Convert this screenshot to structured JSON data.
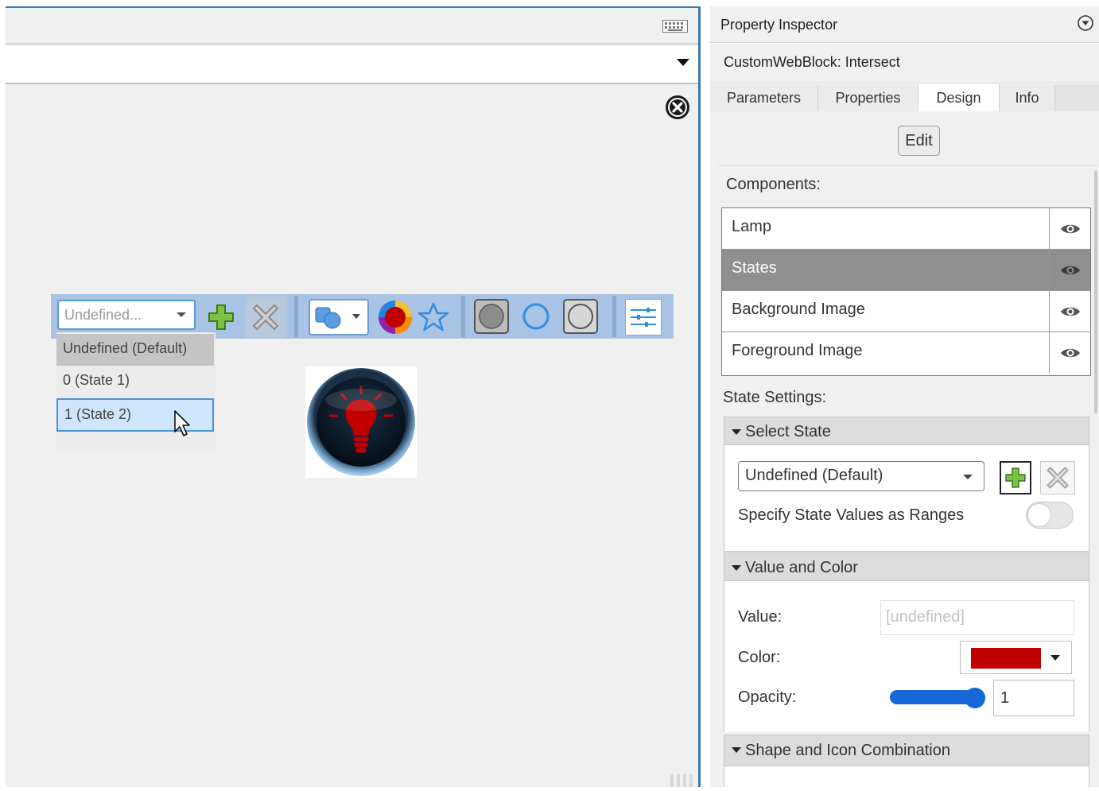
{
  "canvas": {
    "state_dropdown": {
      "selected": "Undefined...",
      "options": [
        "Undefined (Default)",
        "0 (State 1)",
        "1 (State 2)"
      ]
    }
  },
  "inspector": {
    "title": "Property Inspector",
    "block_name": "CustomWebBlock: Intersect",
    "tabs": [
      "Parameters",
      "Properties",
      "Design",
      "Info"
    ],
    "active_tab": "Design",
    "edit_label": "Edit",
    "components_label": "Components:",
    "components": [
      "Lamp",
      "States",
      "Background Image",
      "Foreground Image"
    ],
    "selected_component": "States",
    "state_settings_label": "State Settings:",
    "select_state": {
      "header": "Select State",
      "value": "Undefined (Default)",
      "ranges_label": "Specify State Values as Ranges",
      "ranges_enabled": false
    },
    "value_and_color": {
      "header": "Value and Color",
      "value_label": "Value:",
      "value_placeholder": "[undefined]",
      "color_label": "Color:",
      "color": "#c00000",
      "opacity_label": "Opacity:",
      "opacity": "1"
    },
    "shape_icon_header": "Shape and Icon Combination"
  },
  "icons": {
    "keyboard": "keyboard-icon",
    "close": "close-icon",
    "add": "add-state-icon",
    "delete": "delete-state-icon",
    "eye": "eye-icon",
    "lamp": "lightbulb-lamp-icon"
  },
  "colors": {
    "accent": "#3a7ab3",
    "selected_row": "#8f8f8f",
    "toolbar": "#a9c3e4",
    "lamp_red": "#c00000",
    "slider": "#1668d8"
  }
}
